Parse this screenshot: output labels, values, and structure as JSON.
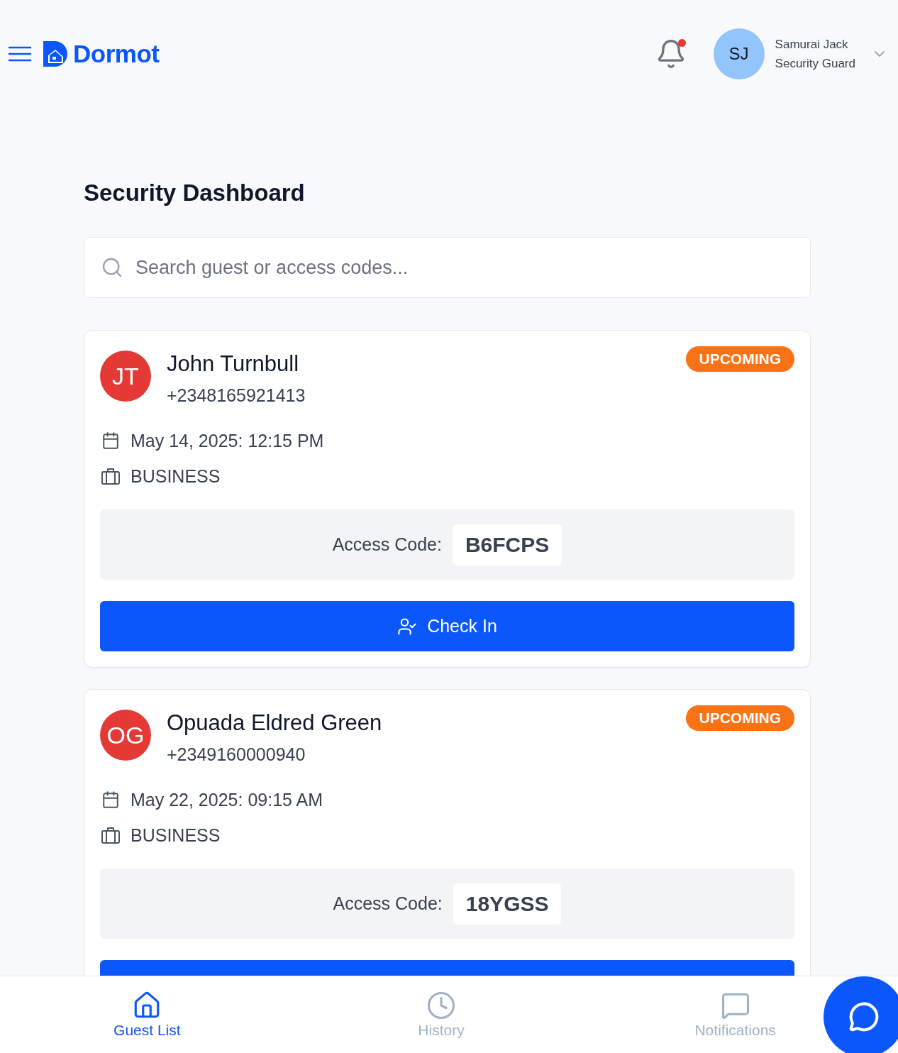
{
  "header": {
    "logo": {
      "text": "Dormot"
    },
    "notifications": {
      "unread": true
    },
    "user": {
      "initials": "SJ",
      "name": "Samurai Jack",
      "role": "Security Guard"
    }
  },
  "page": {
    "title": "Security Dashboard",
    "search": {
      "placeholder": "Search guest or access codes..."
    }
  },
  "guests": [
    {
      "initials": "JT",
      "name": "John Turnbull",
      "phone": "+2348165921413",
      "status": {
        "kind": "upcoming",
        "label": "UPCOMING"
      },
      "datetime": "May 14, 2025: 12:15 PM",
      "purpose": "BUSINESS",
      "access_label": "Access Code:",
      "access_code": "B6FCPS",
      "button": {
        "label": "Check In"
      }
    },
    {
      "initials": "OG",
      "name": "Opuada Eldred Green",
      "phone": "+2349160000940",
      "status": {
        "kind": "upcoming",
        "label": "UPCOMING"
      },
      "datetime": "May 22, 2025: 09:15 AM",
      "purpose": "BUSINESS",
      "access_label": "Access Code:",
      "access_code": "18YGSS"
    }
  ],
  "bottom_nav": {
    "items": [
      {
        "kind": "home",
        "label": "Guest List",
        "selected": true
      },
      {
        "kind": "history",
        "label": "History",
        "selected": false
      },
      {
        "kind": "messages",
        "label": "Notifications",
        "selected": false
      }
    ]
  }
}
